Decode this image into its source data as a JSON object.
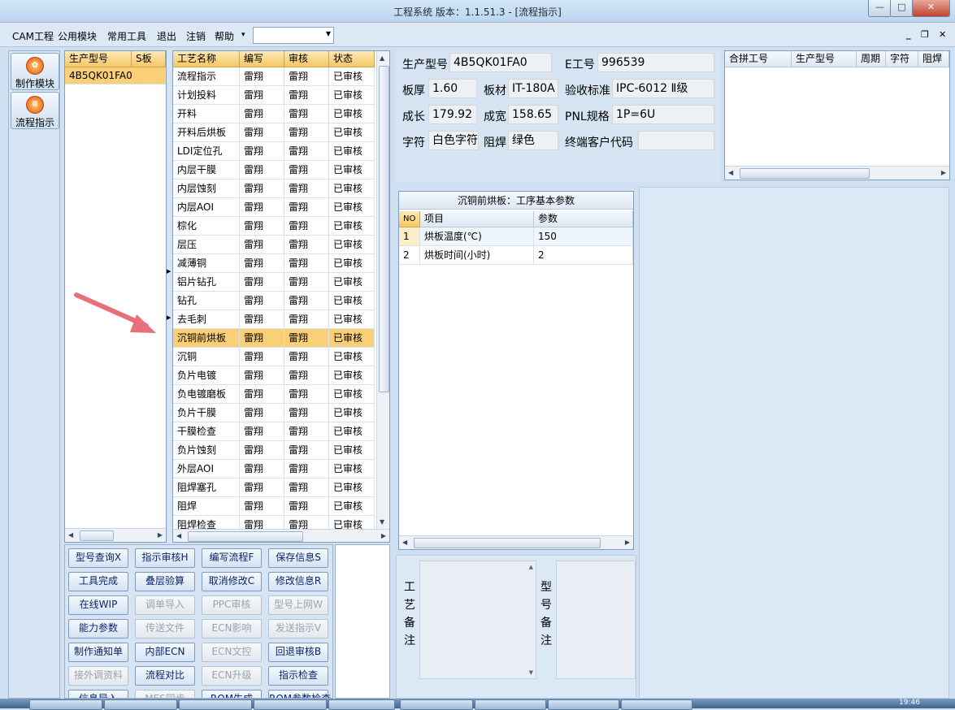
{
  "window": {
    "title": "工程系统   版本：1.1.51.3 - [流程指示]",
    "min": "—",
    "max": "□",
    "close": "✕"
  },
  "menu": {
    "items": [
      "CAM工程",
      "公用模块",
      "常用工具",
      "退出",
      "注销",
      "帮助"
    ],
    "help_arrow": "▾",
    "combo_value": "",
    "mdi": {
      "min": "_",
      "restore": "❐",
      "close": "✕"
    }
  },
  "nav": [
    {
      "label": "制作模块",
      "icon": "gear-icon"
    },
    {
      "label": "流程指示",
      "icon": "flow-icon"
    }
  ],
  "models": {
    "headers": [
      "生产型号",
      "S板"
    ],
    "rows": [
      [
        "4B5QK01FA0",
        ""
      ]
    ]
  },
  "process": {
    "headers": [
      "工艺名称",
      "编写",
      "审核",
      "状态"
    ],
    "selected_index": 14,
    "rows": [
      [
        "流程指示",
        "雷翔",
        "雷翔",
        "已审核"
      ],
      [
        "计划投料",
        "雷翔",
        "雷翔",
        "已审核"
      ],
      [
        "开料",
        "雷翔",
        "雷翔",
        "已审核"
      ],
      [
        "开料后烘板",
        "雷翔",
        "雷翔",
        "已审核"
      ],
      [
        "LDI定位孔",
        "雷翔",
        "雷翔",
        "已审核"
      ],
      [
        "内层干膜",
        "雷翔",
        "雷翔",
        "已审核"
      ],
      [
        "内层蚀刻",
        "雷翔",
        "雷翔",
        "已审核"
      ],
      [
        "内层AOI",
        "雷翔",
        "雷翔",
        "已审核"
      ],
      [
        "棕化",
        "雷翔",
        "雷翔",
        "已审核"
      ],
      [
        "层压",
        "雷翔",
        "雷翔",
        "已审核"
      ],
      [
        "减薄铜",
        "雷翔",
        "雷翔",
        "已审核"
      ],
      [
        "铝片钻孔",
        "雷翔",
        "雷翔",
        "已审核"
      ],
      [
        "钻孔",
        "雷翔",
        "雷翔",
        "已审核"
      ],
      [
        "去毛刺",
        "雷翔",
        "雷翔",
        "已审核"
      ],
      [
        "沉铜前烘板",
        "雷翔",
        "雷翔",
        "已审核"
      ],
      [
        "沉铜",
        "雷翔",
        "雷翔",
        "已审核"
      ],
      [
        "负片电镀",
        "雷翔",
        "雷翔",
        "已审核"
      ],
      [
        "负电镀磨板",
        "雷翔",
        "雷翔",
        "已审核"
      ],
      [
        "负片干膜",
        "雷翔",
        "雷翔",
        "已审核"
      ],
      [
        "干膜检查",
        "雷翔",
        "雷翔",
        "已审核"
      ],
      [
        "负片蚀刻",
        "雷翔",
        "雷翔",
        "已审核"
      ],
      [
        "外层AOI",
        "雷翔",
        "雷翔",
        "已审核"
      ],
      [
        "阻焊塞孔",
        "雷翔",
        "雷翔",
        "已审核"
      ],
      [
        "阻焊",
        "雷翔",
        "雷翔",
        "已审核"
      ],
      [
        "阻焊检查",
        "雷翔",
        "雷翔",
        "已审核"
      ]
    ]
  },
  "info": {
    "model_label": "生产型号",
    "model": "4B5QK01FA0",
    "e_label": "E工号",
    "e_no": "996539",
    "thickness_label": "板厚",
    "thickness": "1.60",
    "material_label": "板材",
    "material": "IT-180A",
    "standard_label": "验收标准",
    "standard": "IPC-6012 Ⅱ级",
    "length_label": "成长",
    "length": "179.92",
    "width_label": "成宽",
    "width": "158.65",
    "pnl_label": "PNL规格",
    "pnl": "1P=6U",
    "char_label": "字符",
    "char": "白色字符",
    "mask_label": "阻焊",
    "mask": "绿色",
    "customer_label": "终端客户代码",
    "customer": ""
  },
  "combined": {
    "headers": [
      "合拼工号",
      "生产型号",
      "周期",
      "字符",
      "阻焊"
    ]
  },
  "params": {
    "title": "沉铜前烘板：工序基本参数",
    "headers": [
      "NO",
      "项目",
      "参数"
    ],
    "rows": [
      [
        "1",
        "烘板温度(℃)",
        "150"
      ],
      [
        "2",
        "烘板时间(小时)",
        "2"
      ]
    ]
  },
  "buttons": [
    {
      "label": "型号查询X",
      "enabled": true
    },
    {
      "label": "指示审核H",
      "enabled": true
    },
    {
      "label": "编写流程F",
      "enabled": true
    },
    {
      "label": "保存信息S",
      "enabled": true
    },
    {
      "label": "工具完成",
      "enabled": true
    },
    {
      "label": "叠层验算",
      "enabled": true
    },
    {
      "label": "取消修改C",
      "enabled": true
    },
    {
      "label": "修改信息R",
      "enabled": true
    },
    {
      "label": "在线WIP",
      "enabled": true
    },
    {
      "label": "调单导入",
      "enabled": false
    },
    {
      "label": "PPC审核",
      "enabled": false
    },
    {
      "label": "型号上网W",
      "enabled": false
    },
    {
      "label": "能力参数",
      "enabled": true
    },
    {
      "label": "传送文件",
      "enabled": false
    },
    {
      "label": "ECN影响",
      "enabled": false
    },
    {
      "label": "发送指示V",
      "enabled": false
    },
    {
      "label": "制作通知单",
      "enabled": true
    },
    {
      "label": "内部ECN",
      "enabled": true
    },
    {
      "label": "ECN文控",
      "enabled": false
    },
    {
      "label": "回退审核B",
      "enabled": true
    },
    {
      "label": "接外调资料",
      "enabled": false
    },
    {
      "label": "流程对比",
      "enabled": true
    },
    {
      "label": "ECN升级",
      "enabled": false
    },
    {
      "label": "指示检查",
      "enabled": true
    },
    {
      "label": "信息导入",
      "enabled": true
    },
    {
      "label": "MES同步",
      "enabled": false
    },
    {
      "label": "ROM生成",
      "enabled": true
    },
    {
      "label": "ROM参数检查",
      "enabled": true
    }
  ],
  "notes": {
    "process_label": "工艺备注",
    "process_text": "",
    "model_label": "型号备注",
    "model_text": ""
  },
  "taskbar": {
    "time": "19:46"
  },
  "colors": {
    "selected": "#fbcf76",
    "header": "#f5c766",
    "accent_red": "#c2432d"
  }
}
